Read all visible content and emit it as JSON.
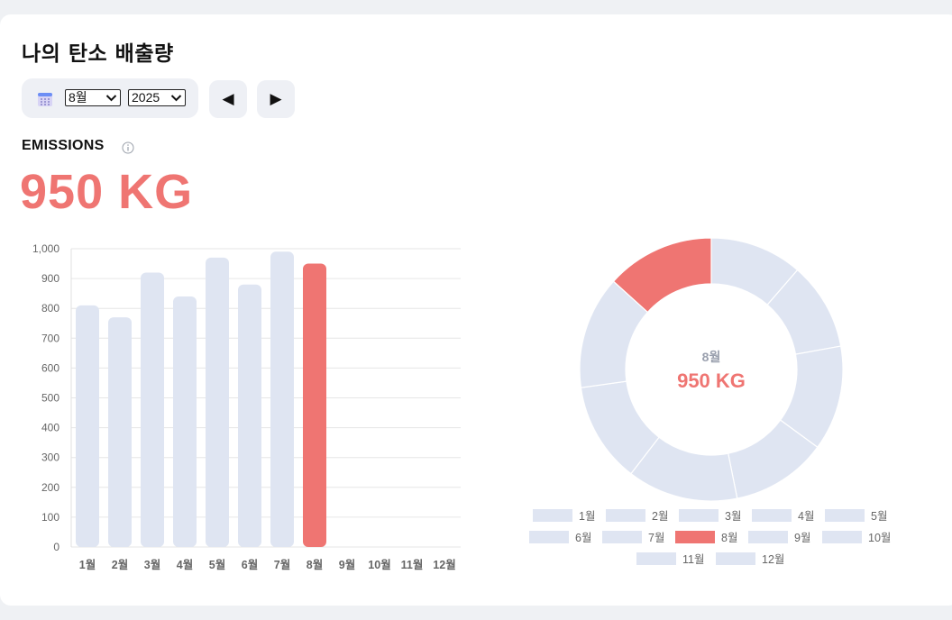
{
  "page": {
    "title": "나의 탄소 배출량",
    "month_select": "8월",
    "year_select": "2025",
    "prev_symbol": "◀",
    "next_symbol": "▶",
    "emissions_label": "EMISSIONS",
    "emissions_value": "950 KG"
  },
  "icons": {
    "calendar": "calendar-icon",
    "info": "info-icon",
    "chevron": "chevron-down-icon"
  },
  "colors": {
    "highlight": "#ef7572",
    "base": "#dfe5f2",
    "accent_text": "#ef7572"
  },
  "chart_data": [
    {
      "type": "bar",
      "categories": [
        "1월",
        "2월",
        "3월",
        "4월",
        "5월",
        "6월",
        "7월",
        "8월",
        "9월",
        "10월",
        "11월",
        "12월"
      ],
      "values": [
        810,
        770,
        920,
        840,
        970,
        880,
        990,
        950,
        null,
        null,
        null,
        null
      ],
      "y_ticks": [
        "0",
        "100",
        "200",
        "300",
        "400",
        "500",
        "600",
        "700",
        "800",
        "900",
        "1,000"
      ],
      "ylim": [
        0,
        1000
      ],
      "highlight": "8월",
      "grid": true
    },
    {
      "type": "pie",
      "donut": true,
      "categories": [
        "1월",
        "2월",
        "3월",
        "4월",
        "5월",
        "6월",
        "7월",
        "8월",
        "9월",
        "10월",
        "11월",
        "12월"
      ],
      "values": [
        810,
        770,
        920,
        840,
        970,
        880,
        990,
        950,
        null,
        null,
        null,
        null
      ],
      "highlight": "8월",
      "center_label": "8월",
      "center_value": "950 KG",
      "legend_position": "bottom"
    }
  ]
}
